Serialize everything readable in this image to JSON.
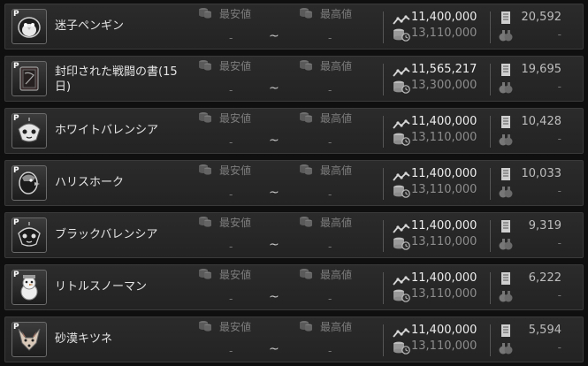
{
  "labels": {
    "min_price": "最安値",
    "max_price": "最高値",
    "tilde": "~",
    "dash": "-"
  },
  "items": [
    {
      "name": "迷子ペンギン",
      "icon": "penguin-pet-icon",
      "trend": "11,400,000",
      "avg": "13,110,000",
      "qty": "20,592",
      "badge": "P"
    },
    {
      "name": "封印された戦闘の書(15日)",
      "icon": "sealed-book-icon",
      "trend": "11,565,217",
      "avg": "13,300,000",
      "qty": "19,695",
      "badge": "P"
    },
    {
      "name": "ホワイトバレンシア",
      "icon": "white-valencia-pet-icon",
      "trend": "11,400,000",
      "avg": "13,110,000",
      "qty": "10,428",
      "badge": "P"
    },
    {
      "name": "ハリスホーク",
      "icon": "harris-hawk-pet-icon",
      "trend": "11,400,000",
      "avg": "13,110,000",
      "qty": "10,033",
      "badge": "P"
    },
    {
      "name": "ブラックバレンシア",
      "icon": "black-valencia-pet-icon",
      "trend": "11,400,000",
      "avg": "13,110,000",
      "qty": "9,319",
      "badge": "P"
    },
    {
      "name": "リトルスノーマン",
      "icon": "little-snowman-pet-icon",
      "trend": "11,400,000",
      "avg": "13,110,000",
      "qty": "6,222",
      "badge": "P"
    },
    {
      "name": "砂漠キツネ",
      "icon": "desert-fox-pet-icon",
      "trend": "11,400,000",
      "avg": "13,110,000",
      "qty": "5,594",
      "badge": "P"
    }
  ],
  "icons": {
    "coins": "coins-icon",
    "trend": "trend-line-icon",
    "avg": "coin-stack-clock-icon",
    "qty": "scroll-icon",
    "bag": "money-bag-icon"
  },
  "colors": {
    "row_bg": "#262626",
    "text": "#e4e4e4",
    "muted": "#7d7d7d"
  }
}
